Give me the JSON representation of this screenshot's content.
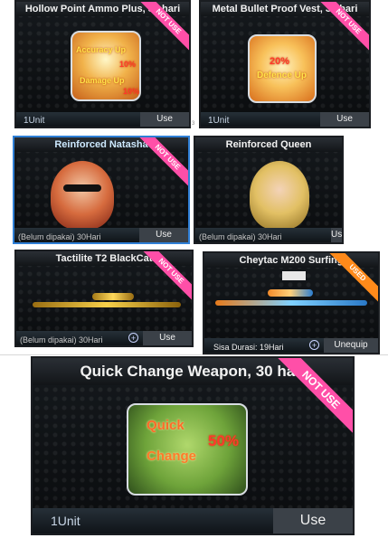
{
  "cards": {
    "hollow": {
      "title": "Hollow Point Ammo Plus, 30 hari",
      "ribbon": "NOT USE",
      "line1": "Accuracy Up",
      "line1_val": "10%",
      "line2": "Damage Up",
      "line2_val": "10%",
      "unit": "1Unit",
      "button": "Use"
    },
    "vest": {
      "title": "Metal Bullet Proof Vest, 30 hari",
      "ribbon": "NOT USE",
      "val": "20%",
      "label": "Defence Up",
      "unit": "1Unit",
      "button": "Use",
      "edge_marker": "3"
    },
    "natasha": {
      "title": "Reinforced Natasha",
      "ribbon": "NOT USE",
      "sub": "(Belum dipakai) 30Hari",
      "button": "Use"
    },
    "queen": {
      "title": "Reinforced Queen",
      "sub": "(Belum dipakai) 30Hari",
      "button": "Use"
    },
    "tactilite": {
      "title": "Tactilite T2 BlackCat",
      "ribbon": "NOT USE",
      "sub": "(Belum dipakai) 30Hari",
      "button": "Use"
    },
    "cheytac": {
      "title": "Cheytac M200 Surfing",
      "ribbon": "USED",
      "sub": "Sisa Durasi: 19Hari",
      "button": "Unequip"
    },
    "quick": {
      "title": "Quick Change Weapon, 30 hari",
      "ribbon": "NOT USE",
      "line1": "Quick",
      "val": "50%",
      "line2": "Change",
      "unit": "1Unit",
      "button": "Use"
    }
  },
  "colors": {
    "ribbon_pink": "#ff4fa8",
    "ribbon_orange": "#ff8a1a",
    "frame_blue": "#2f7fd6"
  }
}
